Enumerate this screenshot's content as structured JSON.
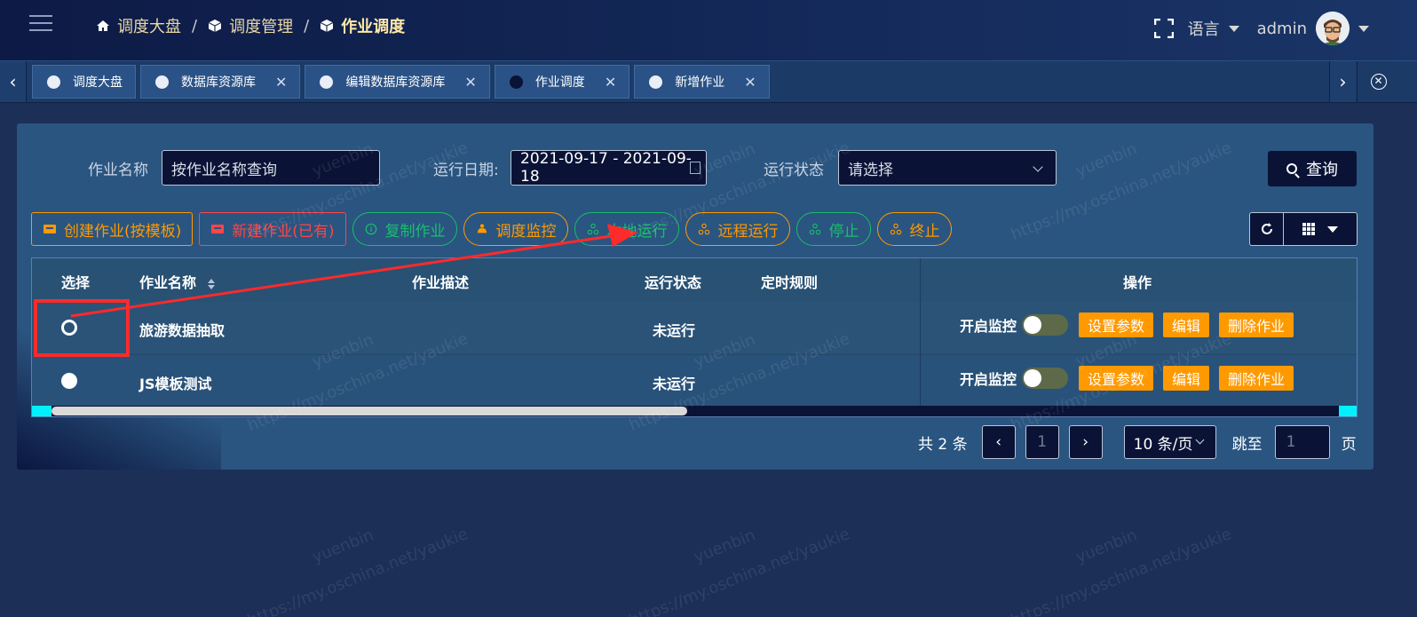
{
  "header": {
    "breadcrumb": [
      "调度大盘",
      "调度管理",
      "作业调度"
    ],
    "language_label": "语言",
    "username": "admin"
  },
  "tabs": [
    {
      "label": "调度大盘",
      "closable": false,
      "active": false
    },
    {
      "label": "数据库资源库",
      "closable": true,
      "active": false
    },
    {
      "label": "编辑数据库资源库",
      "closable": true,
      "active": false
    },
    {
      "label": "作业调度",
      "closable": true,
      "active": true
    },
    {
      "label": "新增作业",
      "closable": true,
      "active": false
    }
  ],
  "search": {
    "job_name_label": "作业名称",
    "job_name_placeholder": "按作业名称查询",
    "run_date_label": "运行日期:",
    "run_date_value": "2021-09-17 - 2021-09-18",
    "run_status_label": "运行状态",
    "run_status_placeholder": "请选择",
    "query_label": "查询"
  },
  "actions": {
    "create_template": "创建作业(按模板)",
    "create_existing": "新建作业(已有)",
    "copy": "复制作业",
    "monitor": "调度监控",
    "run_local": "本地运行",
    "run_remote": "远程运行",
    "stop": "停止",
    "terminate": "终止"
  },
  "table": {
    "headers": {
      "select": "选择",
      "name": "作业名称",
      "desc": "作业描述",
      "status": "运行状态",
      "schedule": "定时规则",
      "ops": "操作"
    },
    "rows": [
      {
        "name": "旅游数据抽取",
        "desc": "",
        "status": "未运行",
        "schedule": "",
        "selected": false
      },
      {
        "name": "JS模板测试",
        "desc": "",
        "status": "未运行",
        "schedule": "",
        "selected": false
      }
    ],
    "ops_labels": {
      "monitor_switch": "开启监控",
      "set_params": "设置参数",
      "edit": "编辑",
      "delete": "删除作业"
    }
  },
  "pagination": {
    "total_text": "共 2 条",
    "current_page": "1",
    "page_size": "10 条/页",
    "jump_label": "跳至",
    "jump_value": "1",
    "page_unit": "页"
  },
  "watermark": {
    "name": "yuenbin",
    "url": "https://my.oschina.net/yaukie"
  },
  "colors": {
    "orange": "#ff9900",
    "red": "#ff4545",
    "green": "#19be6b",
    "annotation": "#ff2a2a",
    "scroll_cap": "#00f0ff"
  }
}
